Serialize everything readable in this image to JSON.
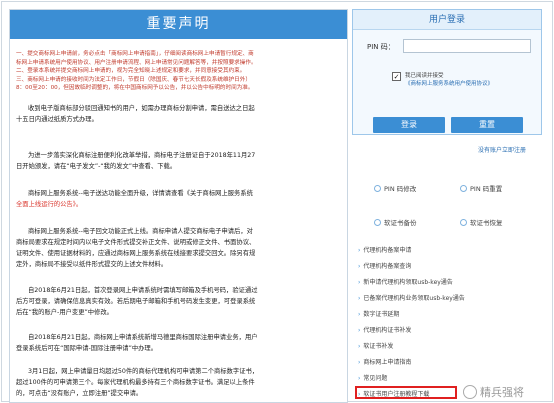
{
  "banner": {
    "title": "重要声明"
  },
  "notice": [
    "一、提交商标网上申请前，务必点击「商标网上申请指南」，仔细阅读商标网上申请暂行规定、商",
    "标网上申请系统用户使用协议、用户注册申请流程、网上申请常见问题解答等，并按照要求操作。",
    "二、登录本系统并提交商标网上申请的，视为完全知晓上述规定和要求，并同意接受其约束。",
    "三、商标网上申请的接收时间为法定工作日，节假日（除国庆、春节七天长假及系统维护日外）",
    "8：00至20：00，但因故临时调整的，将在中国商标网予以公告，并以公告中标明的时间为准。"
  ],
  "paragraphs": [
    [
      "收到电子版商标部分驳回通知书的用户，如需办理商标分割申请，需自送达之日起",
      "十五日内通过纸质方式办理。"
    ],
    [
      "为进一步落实深化商标注册便利化改革举措，商标电子注册证自于2018年11月27",
      "日开始颁发，请在“电子发文”-“我的发文”中查看、下载。"
    ],
    [
      "商标网上服务系统--电子送达功能全面升级，详情请查看《关于商标网上服务系统",
      "全面上线运行的公告》。"
    ],
    [
      "商标网上服务系统--电子回文功能正式上线。商标申请人提交商标电子申请后，对",
      "商标局要求在规定时间内以电子文件形式提交补正文件、说明或修正文件、书面协议、",
      "证明文件、使用证据材料的，应通过商标网上服务系统在线接要求提交回文。除另有规",
      "定外，商标局不接受以纸件形式提交的上述文件材料。"
    ],
    [
      "自2018年6月21日起，首次登录网上申请系统时需填写邮箱及手机号码，验证通过",
      "后方可登录，请确保信息真实有效。若后期电子邮箱和手机号码发生变更，可登录系统",
      "后在“我的账户-用户变更”中修改。"
    ],
    [
      "自2018年6月21日起，商标网上申请系统新增马德里商标国际注册申请业务，用户",
      "登录系统后可在“国际申请-国际注册申请”中办理。"
    ],
    [
      "3月1日起，网上申请量日均超过50件的商标代理机构可申请第二个商标数字证书，",
      "超过100件的可申请第三个。每家代理机构最多持有三个商标数字证书。满足以上条件",
      "的，可点击“没有账户，立即注册”提交申请。"
    ]
  ],
  "login": {
    "title": "用户登录",
    "pin_label": "PIN 码：",
    "pin_value": "",
    "agree_line1": "我已阅读并接受",
    "agree_line2": "《商标网上服务系统用户使用协议》",
    "agree_checked": "✓",
    "login_button": "登录",
    "reset_button": "重置"
  },
  "no_account_link": "没有账户立即注册",
  "quick_actions": [
    "PIN 码修改",
    "PIN 码重置",
    "软证书备份",
    "软证书恢复"
  ],
  "links": [
    "代理机构备案申请",
    "代理机构备案查询",
    "新申请代理机构领取usb-key通告",
    "已备案代理机构业务领取usb-key通告",
    "数字证书延期",
    "代理机构证书补发",
    "软证书补发",
    "商标网上申请指南",
    "常见问题",
    "软证书用户注册教程下载"
  ],
  "watermark": "精兵强将"
}
